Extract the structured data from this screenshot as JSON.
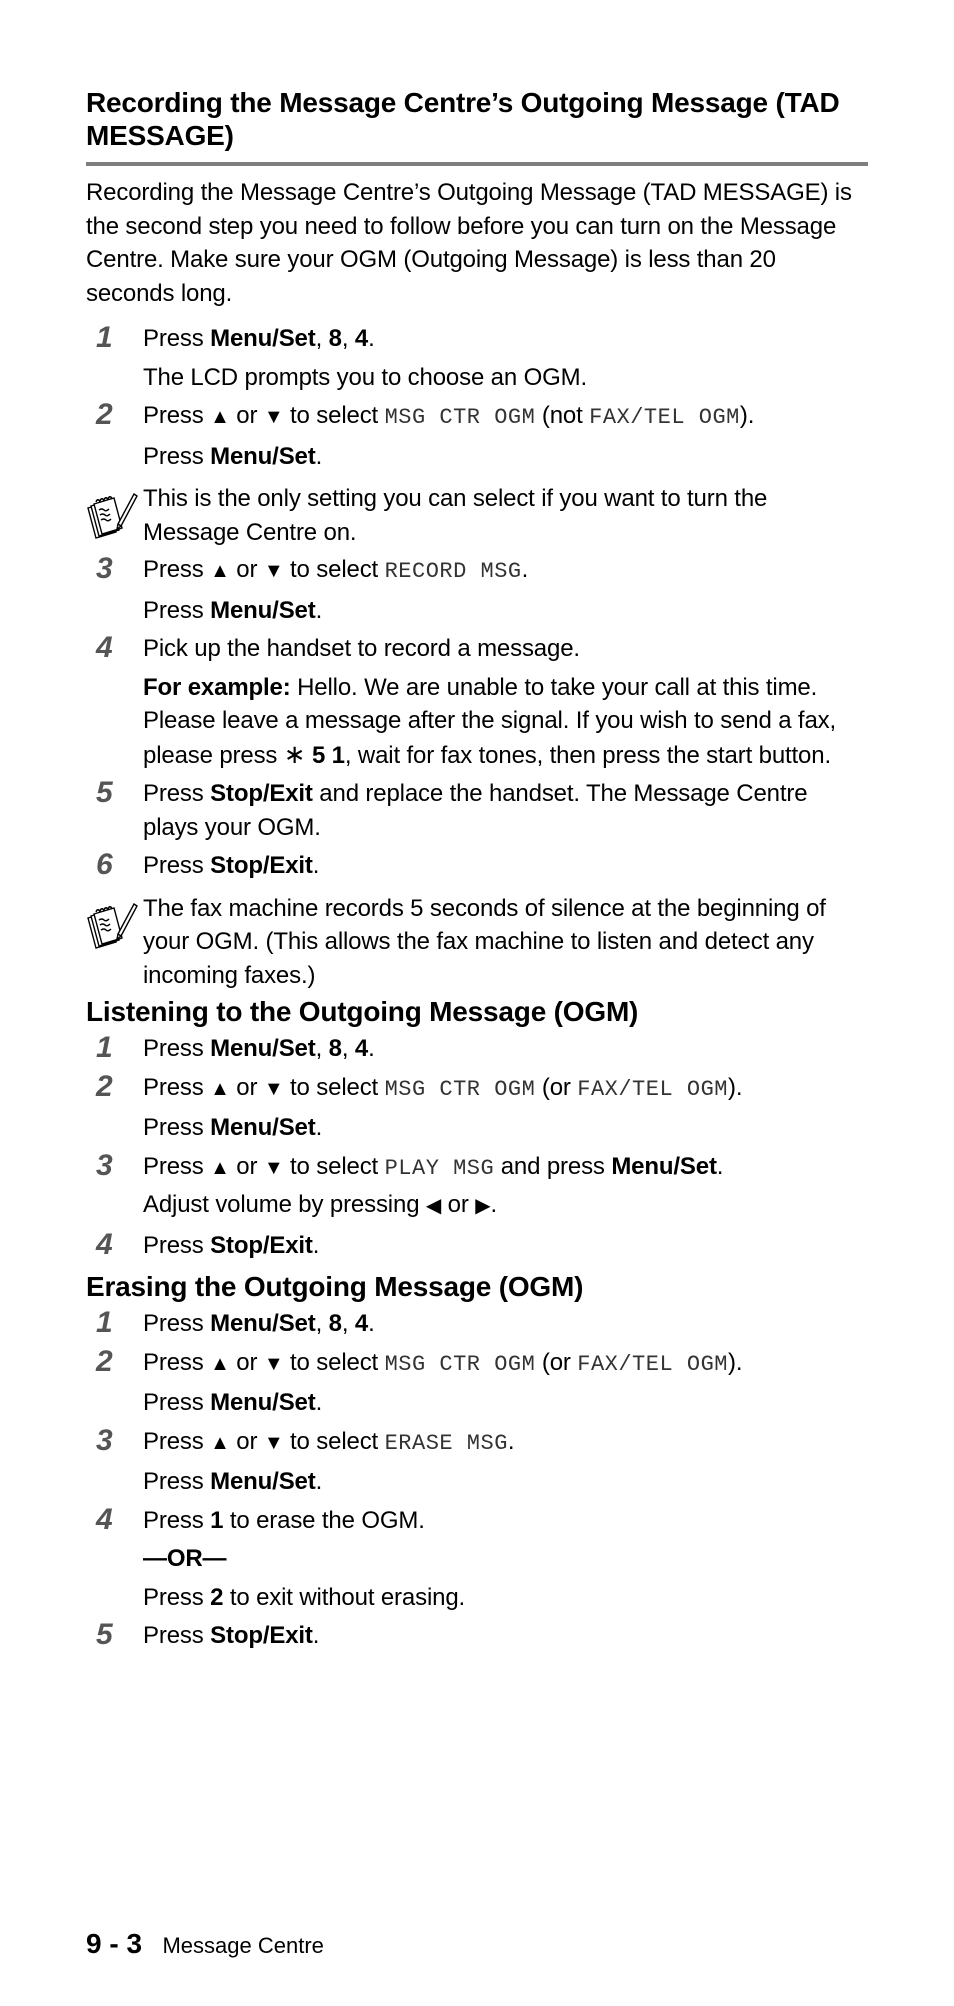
{
  "section1": {
    "title": "Recording the Message Centre’s Outgoing Message (TAD MESSAGE)",
    "intro": "Recording the Message Centre’s Outgoing Message (TAD MESSAGE) is the second step you need to follow before you can turn on the Message Centre. Make sure your OGM (Outgoing Message) is less than 20 seconds long.",
    "steps": [
      {
        "num": "1",
        "press": "Press ",
        "keys": "Menu/Set",
        "sep1": ", ",
        "k2": "8",
        "sep2": ", ",
        "k3": "4",
        "end": ".",
        "sub": "The LCD prompts you to choose an OGM."
      },
      {
        "num": "2",
        "a": "Press ",
        "up": "▲",
        "or": " or ",
        "down": "▼",
        "b": " to select ",
        "lcd1": "MSG CTR OGM",
        "c": " (not ",
        "lcd2": "FAX/TEL OGM",
        "d": ").",
        "sub_press": "Press ",
        "sub_key": "Menu/Set",
        "sub_end": "."
      },
      {
        "num": "3",
        "a": "Press ",
        "up": "▲",
        "or": " or ",
        "down": "▼",
        "b": " to select ",
        "lcd1": "RECORD MSG",
        "d": ".",
        "sub_press": "Press ",
        "sub_key": "Menu/Set",
        "sub_end": "."
      },
      {
        "num": "4",
        "text": "Pick up the handset to record a message.",
        "ex_label": "For example:",
        "ex_text": " Hello. We are unable to take your call at this time. Please leave a message after the signal. If you wish to send a fax, please press ",
        "ex_star": "∗",
        "ex_keys": " 5 1",
        "ex_end": ", wait for fax tones, then press the start button."
      },
      {
        "num": "5",
        "press": "Press ",
        "key": "Stop/Exit",
        "text": " and replace the handset. The Message Centre plays your OGM."
      },
      {
        "num": "6",
        "press": "Press ",
        "key": "Stop/Exit",
        "end": "."
      }
    ],
    "note1": "This is the only setting you can select if you want to turn the Message Centre on.",
    "note2": "The fax machine records 5 seconds of silence at the beginning of your OGM. (This allows the fax machine to listen and detect any incoming faxes.)"
  },
  "section2": {
    "title": "Listening to the Outgoing Message (OGM)",
    "steps": [
      {
        "num": "1",
        "press": "Press ",
        "keys": "Menu/Set",
        "sep1": ", ",
        "k2": "8",
        "sep2": ", ",
        "k3": "4",
        "end": "."
      },
      {
        "num": "2",
        "a": "Press ",
        "up": "▲",
        "or": " or ",
        "down": "▼",
        "b": " to select ",
        "lcd1": "MSG CTR OGM",
        "c": " (or ",
        "lcd2": "FAX/TEL OGM",
        "d": ").",
        "sub_press": "Press ",
        "sub_key": "Menu/Set",
        "sub_end": "."
      },
      {
        "num": "3",
        "a": "Press ",
        "up": "▲",
        "or": " or ",
        "down": "▼",
        "b": " to select ",
        "lcd1": "PLAY MSG",
        "c": " and press ",
        "key": "Menu/Set",
        "d": ".",
        "vol_text": "Adjust volume by pressing ",
        "left": "◀",
        "vol_or": " or ",
        "right": "▶",
        "vol_end": "."
      },
      {
        "num": "4",
        "press": "Press ",
        "key": "Stop/Exit",
        "end": "."
      }
    ]
  },
  "section3": {
    "title": "Erasing the Outgoing Message (OGM)",
    "steps": [
      {
        "num": "1",
        "press": "Press ",
        "keys": "Menu/Set",
        "sep1": ", ",
        "k2": "8",
        "sep2": ", ",
        "k3": "4",
        "end": "."
      },
      {
        "num": "2",
        "a": "Press ",
        "up": "▲",
        "or": " or ",
        "down": "▼",
        "b": " to select ",
        "lcd1": "MSG CTR OGM",
        "c": " (or ",
        "lcd2": "FAX/TEL OGM",
        "d": ").",
        "sub_press": "Press ",
        "sub_key": "Menu/Set",
        "sub_end": "."
      },
      {
        "num": "3",
        "a": "Press ",
        "up": "▲",
        "or": " or ",
        "down": "▼",
        "b": " to select ",
        "lcd1": "ERASE MSG",
        "d": ".",
        "sub_press": "Press ",
        "sub_key": "Menu/Set",
        "sub_end": "."
      },
      {
        "num": "4",
        "press": "Press ",
        "key": "1",
        "text": " to erase the OGM.",
        "or_label": "—OR—",
        "alt_press": "Press ",
        "alt_key": "2",
        "alt_text": " to exit without erasing."
      },
      {
        "num": "5",
        "press": "Press ",
        "key": "Stop/Exit",
        "end": "."
      }
    ]
  },
  "footer": {
    "page_number": "9 - 3",
    "section_name": "Message Centre"
  }
}
